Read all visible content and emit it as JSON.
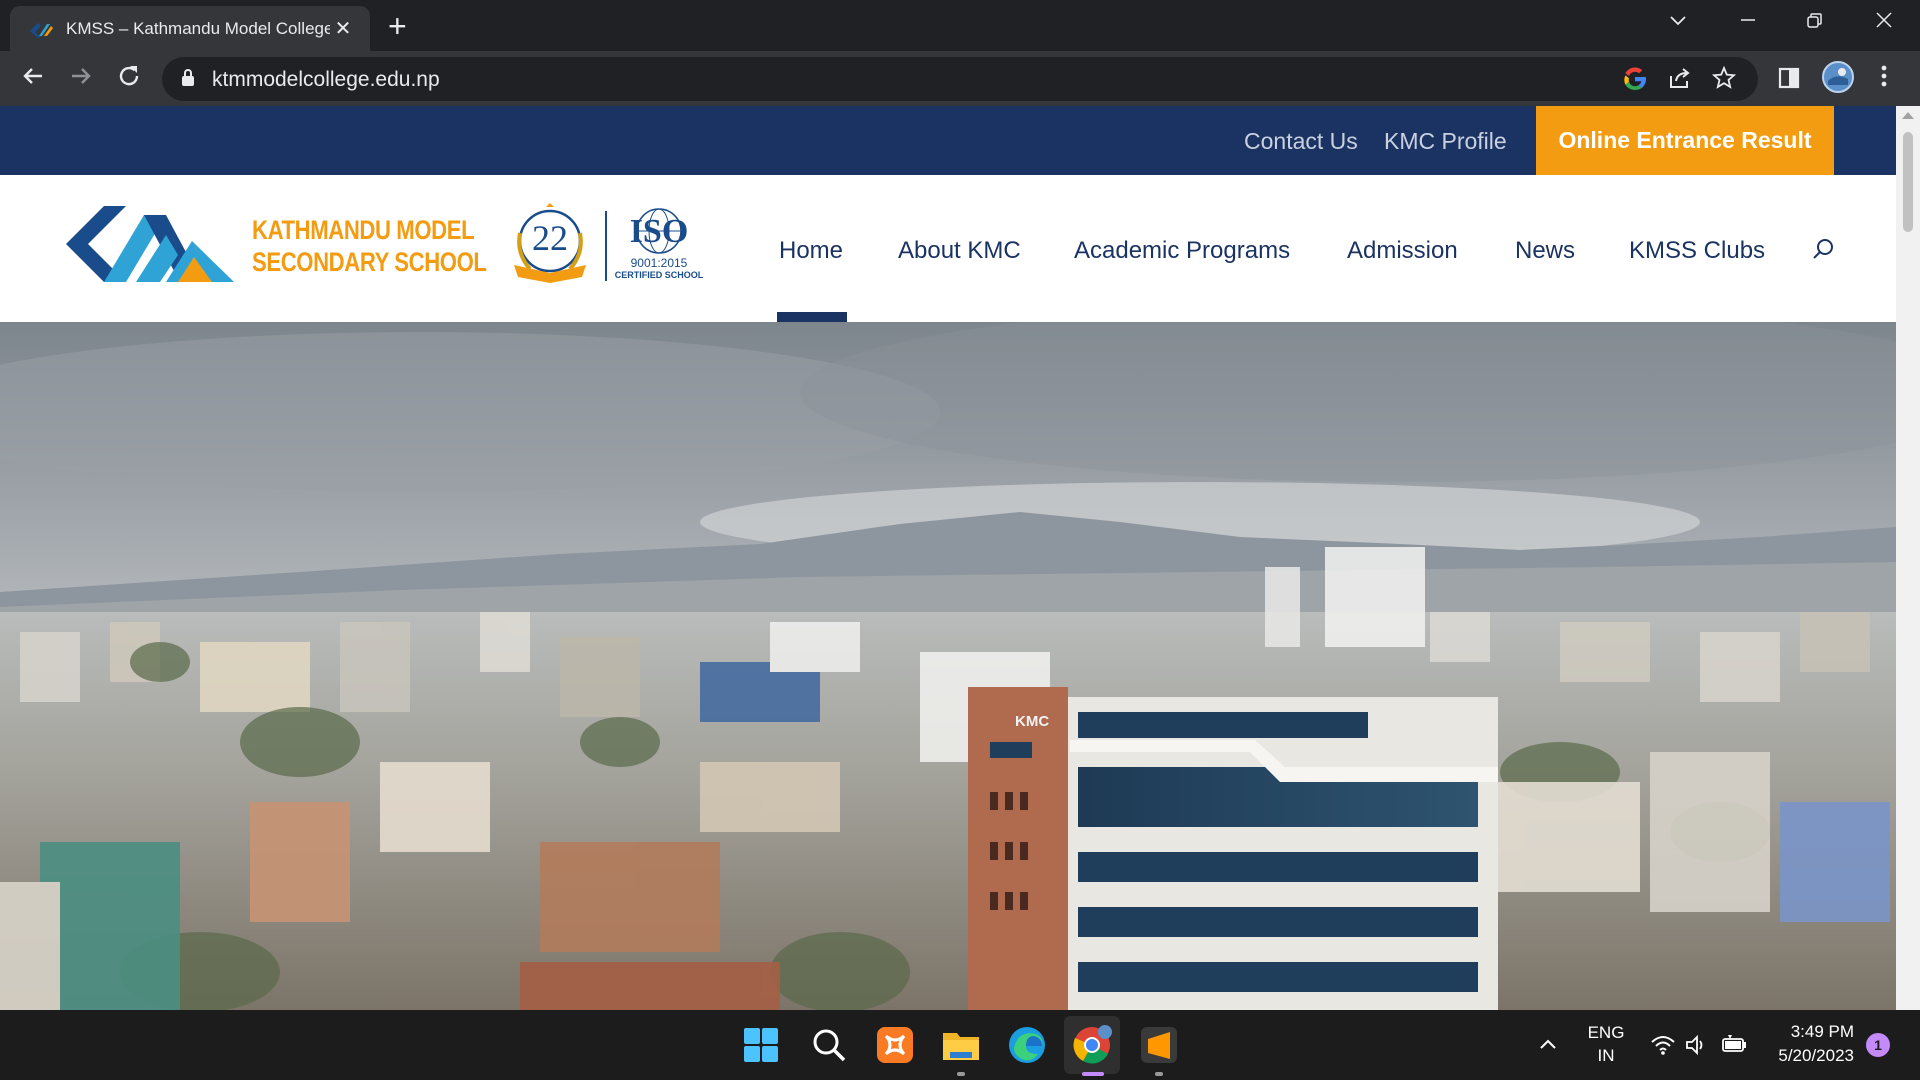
{
  "browser": {
    "tab_title": "KMSS – Kathmandu Model College",
    "url": "ktmmodelcollege.edu.np"
  },
  "topbar": {
    "contact_us": "Contact Us",
    "kmc_profile": "KMC Profile",
    "cta": "Online Entrance Result"
  },
  "logo": {
    "line1": "KATHMANDU MODEL",
    "line2": "SECONDARY SCHOOL",
    "badge_number": "22",
    "iso_title": "ISO",
    "iso_number": "9001:2015",
    "iso_caption": "CERTIFIED SCHOOL"
  },
  "menu": {
    "items": [
      {
        "label": "Home",
        "active": true
      },
      {
        "label": "About KMC"
      },
      {
        "label": "Academic Programs"
      },
      {
        "label": "Admission"
      },
      {
        "label": "News"
      },
      {
        "label": "KMSS Clubs"
      }
    ]
  },
  "hero": {
    "building_sign": "KMC"
  },
  "taskbar": {
    "lang_line1": "ENG",
    "lang_line2": "IN",
    "time": "3:49 PM",
    "date": "5/20/2023",
    "notification_count": "1"
  },
  "colors": {
    "navy": "#1b3362",
    "orange": "#f39c12",
    "logo_blue": "#1a4c8b",
    "logo_cyan": "#2fa3d6"
  }
}
